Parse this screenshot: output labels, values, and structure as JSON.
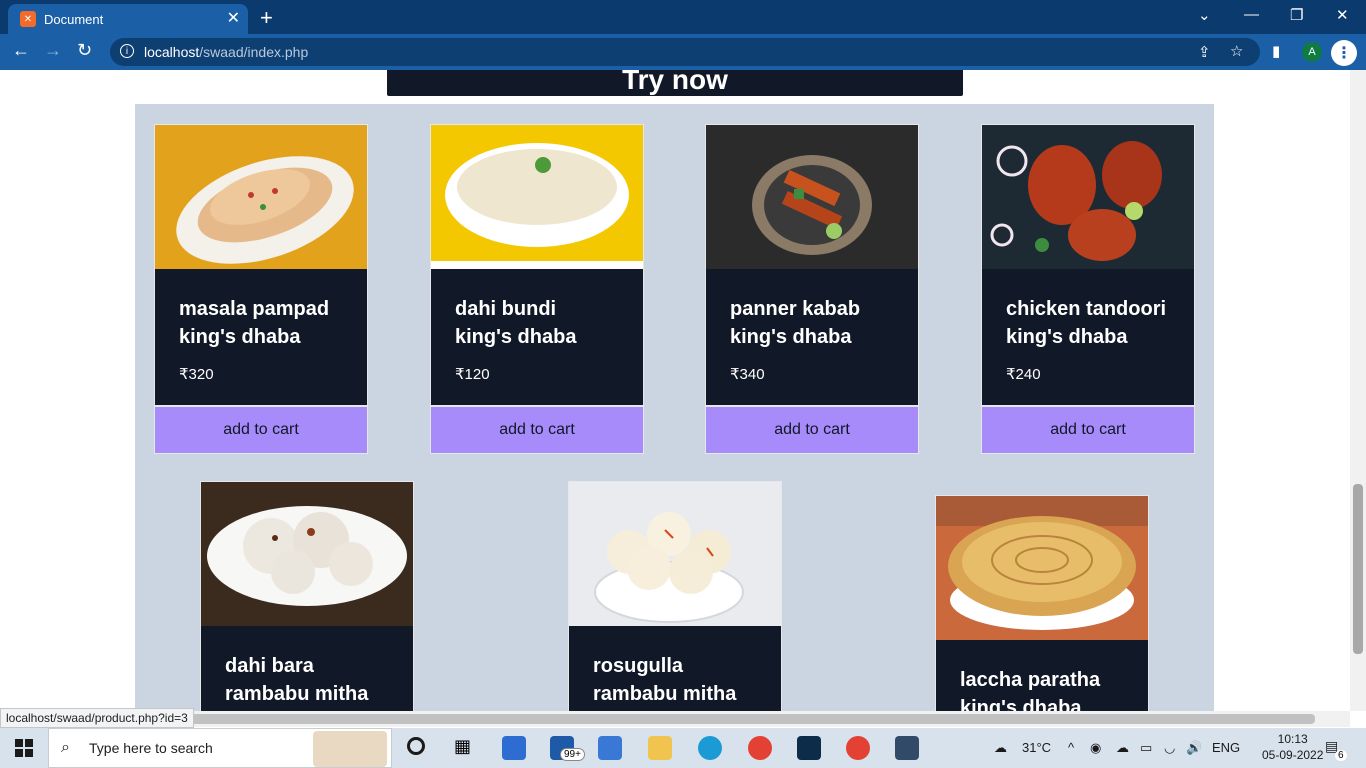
{
  "browser": {
    "tab_title": "Document",
    "tab_favicon": "xampp-icon",
    "url_host": "localhost",
    "url_path": "/swaad/index.php",
    "profile_initial": "A"
  },
  "page": {
    "try_button": "Try now",
    "cart_label": "add to cart",
    "products": [
      {
        "name": "masala pampad",
        "shop": "king's dhaba",
        "price": "₹320"
      },
      {
        "name": "dahi bundi",
        "shop": "king's dhaba",
        "price": "₹120"
      },
      {
        "name": "panner kabab",
        "shop": "king's dhaba",
        "price": "₹340"
      },
      {
        "name": "chicken tandoori",
        "shop": "king's dhaba",
        "price": "₹240"
      },
      {
        "name": "dahi bara",
        "shop": "rambabu mitha",
        "price": ""
      },
      {
        "name": "rosugulla",
        "shop": "rambabu mitha",
        "price": ""
      },
      {
        "name": "laccha paratha",
        "shop": "king's dhaba",
        "price": ""
      }
    ],
    "status_url": "localhost/swaad/product.php?id=3"
  },
  "taskbar": {
    "search_placeholder": "Type here to search",
    "weather": "31°C",
    "language": "ENG",
    "time": "10:13",
    "date": "05-09-2022",
    "notifications": "6",
    "mail_badge": "99+"
  },
  "colors": {
    "card_bg": "#111827",
    "cart_bg": "#a78bfa",
    "panel_bg": "#cbd5e1"
  }
}
